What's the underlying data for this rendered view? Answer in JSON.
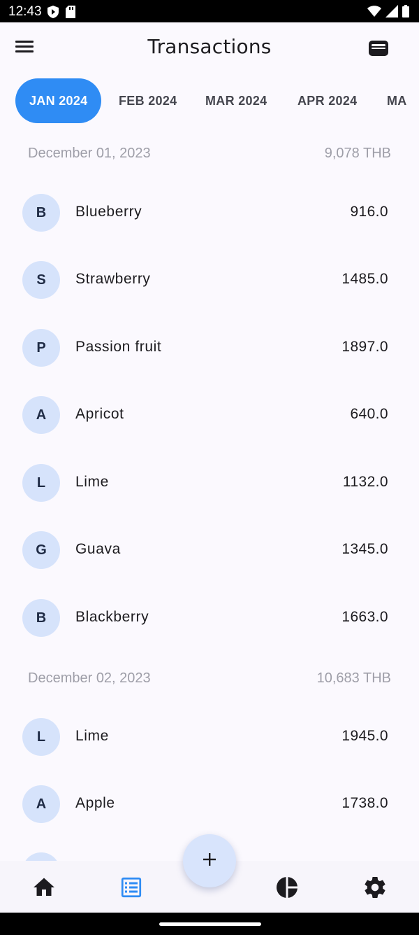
{
  "status_bar": {
    "time": "12:43",
    "left_icons": [
      "shield-play-icon",
      "sd-card-icon"
    ],
    "right_icons": [
      "wifi-icon",
      "signal-icon",
      "battery-icon"
    ]
  },
  "app_bar": {
    "title": "Transactions",
    "menu_icon": "menu-icon",
    "action_icon": "wallet-icon"
  },
  "tabs": [
    {
      "label": "JAN 2024",
      "active": true
    },
    {
      "label": "FEB 2024",
      "active": false
    },
    {
      "label": "MAR 2024",
      "active": false
    },
    {
      "label": "APR 2024",
      "active": false
    },
    {
      "label": "MA",
      "active": false
    }
  ],
  "groups": [
    {
      "date": "December 01, 2023",
      "total": "9,078 THB",
      "items": [
        {
          "initial": "B",
          "name": "Blueberry",
          "amount": "916.0"
        },
        {
          "initial": "S",
          "name": "Strawberry",
          "amount": "1485.0"
        },
        {
          "initial": "P",
          "name": "Passion fruit",
          "amount": "1897.0"
        },
        {
          "initial": "A",
          "name": "Apricot",
          "amount": "640.0"
        },
        {
          "initial": "L",
          "name": "Lime",
          "amount": "1132.0"
        },
        {
          "initial": "G",
          "name": "Guava",
          "amount": "1345.0"
        },
        {
          "initial": "B",
          "name": "Blackberry",
          "amount": "1663.0"
        }
      ]
    },
    {
      "date": "December 02, 2023",
      "total": "10,683 THB",
      "items": [
        {
          "initial": "L",
          "name": "Lime",
          "amount": "1945.0"
        },
        {
          "initial": "A",
          "name": "Apple",
          "amount": "1738.0"
        }
      ]
    }
  ],
  "fab": {
    "icon": "plus-icon"
  },
  "bottom_nav": [
    {
      "icon": "home-icon",
      "active": false
    },
    {
      "icon": "list-icon",
      "active": true
    },
    {
      "icon": "pie-chart-icon",
      "active": false
    },
    {
      "icon": "settings-icon",
      "active": false
    }
  ],
  "colors": {
    "accent": "#2f8cf4",
    "avatar_bg": "#d6e3fb",
    "background": "#fbf9fe",
    "muted_text": "#9e9ea8"
  }
}
